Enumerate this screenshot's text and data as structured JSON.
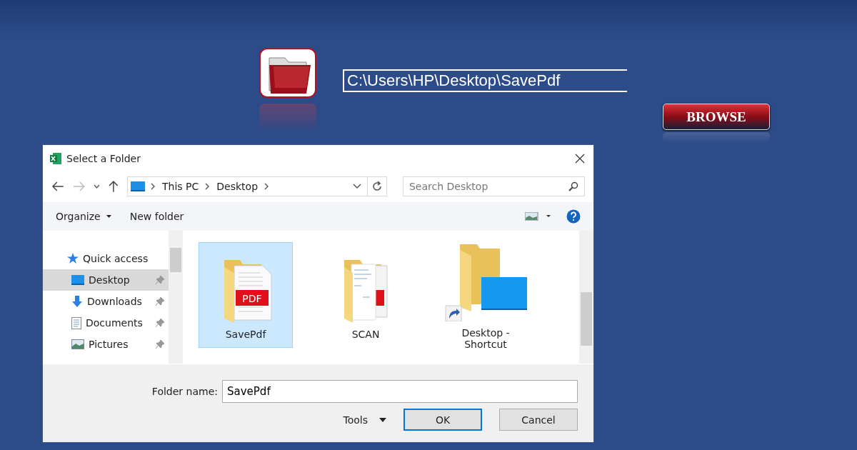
{
  "app": {
    "path": "C:\\Users\\HP\\Desktop\\SavePdf",
    "browse": "BROWSE"
  },
  "dialog": {
    "title": "Select a Folder",
    "breadcrumb": [
      "This PC",
      "Desktop"
    ],
    "search": {
      "placeholder": "Search Desktop"
    },
    "toolbar": {
      "organize": "Organize",
      "new_folder": "New folder"
    },
    "nav": [
      {
        "label": "Quick access",
        "kind": "header",
        "selected": false,
        "pinned": false
      },
      {
        "label": "Desktop",
        "kind": "desktop",
        "selected": true,
        "pinned": true
      },
      {
        "label": "Downloads",
        "kind": "downloads",
        "selected": false,
        "pinned": true
      },
      {
        "label": "Documents",
        "kind": "documents",
        "selected": false,
        "pinned": true
      },
      {
        "label": "Pictures",
        "kind": "pictures",
        "selected": false,
        "pinned": true
      }
    ],
    "files": [
      {
        "name": "SavePdf",
        "kind": "pdf",
        "selected": true,
        "badge": "PDF"
      },
      {
        "name": "SCAN",
        "kind": "docs",
        "selected": false
      },
      {
        "name": "Desktop - Shortcut",
        "kind": "shortcut",
        "selected": false
      }
    ],
    "folder_label": "Folder name:",
    "folder_value": "SavePdf",
    "tools": "Tools",
    "ok": "OK",
    "cancel": "Cancel"
  }
}
